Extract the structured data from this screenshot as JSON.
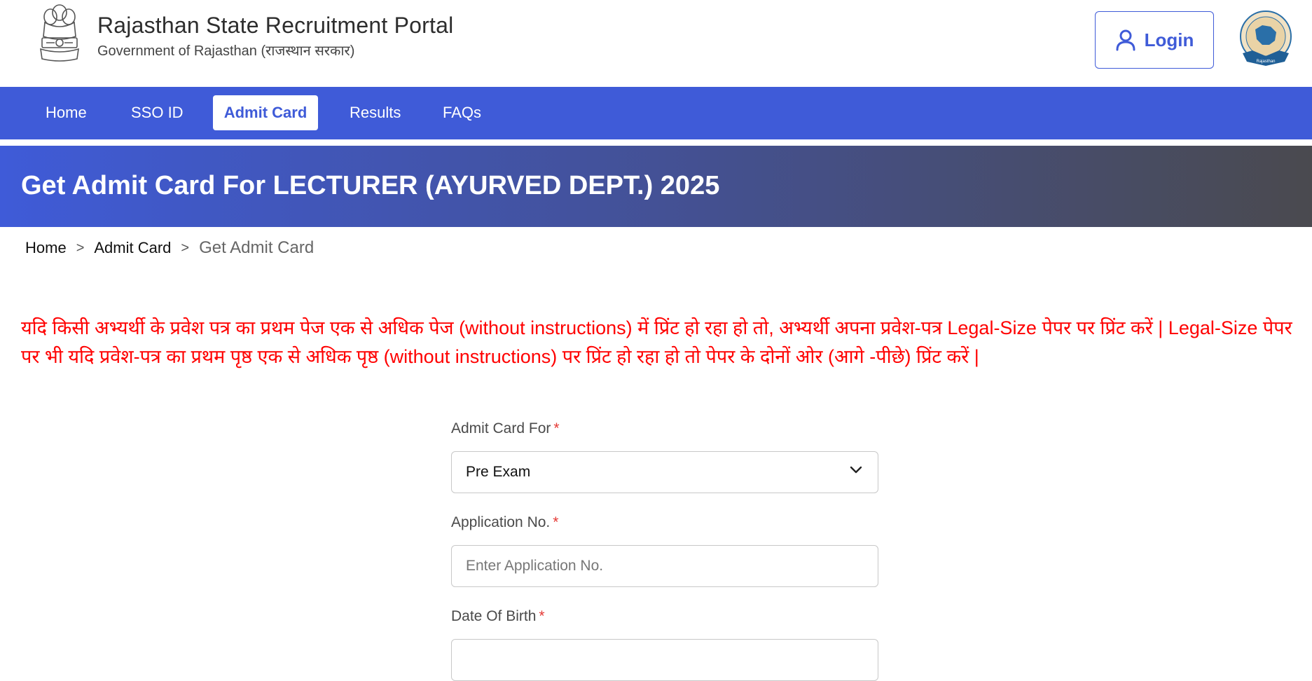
{
  "header": {
    "title": "Rajasthan State Recruitment Portal",
    "subtitle": "Government of Rajasthan (राजस्थान सरकार)",
    "login_label": "Login",
    "seal_text": "Rajasthan"
  },
  "nav": {
    "items": [
      {
        "label": "Home"
      },
      {
        "label": "SSO ID"
      },
      {
        "label": "Admit Card"
      },
      {
        "label": "Results"
      },
      {
        "label": "FAQs"
      }
    ],
    "active": "Admit Card"
  },
  "banner": {
    "title": "Get Admit Card For LECTURER (AYURVED DEPT.) 2025"
  },
  "breadcrumb": {
    "items": [
      "Home",
      "Admit Card",
      "Get Admit Card"
    ],
    "separator": ">"
  },
  "notice": {
    "text": "यदि किसी अभ्यर्थी के प्रवेश पत्र का प्रथम पेज एक से अधिक पेज (without instructions) में प्रिंट हो रहा हो तो, अभ्यर्थी अपना प्रवेश-पत्र Legal-Size पेपर पर प्रिंट करें | Legal-Size पेपर पर भी यदि प्रवेश-पत्र का प्रथम पृष्ठ एक से अधिक पृष्ठ (without instructions) पर प्रिंट हो रहा हो तो पेपर के दोनों ओर (आगे -पीछे) प्रिंट करें |",
    "color": "#ff0000"
  },
  "form": {
    "admit_card_for": {
      "label": "Admit Card For",
      "value": "Pre Exam",
      "required_mark": "*"
    },
    "application_no": {
      "label": "Application No.",
      "placeholder": "Enter Application No.",
      "value": "",
      "required_mark": "*"
    },
    "dob": {
      "label": "Date Of Birth",
      "required_mark": "*"
    }
  },
  "colors": {
    "primary": "#3f5bd8",
    "required": "#e53935"
  }
}
